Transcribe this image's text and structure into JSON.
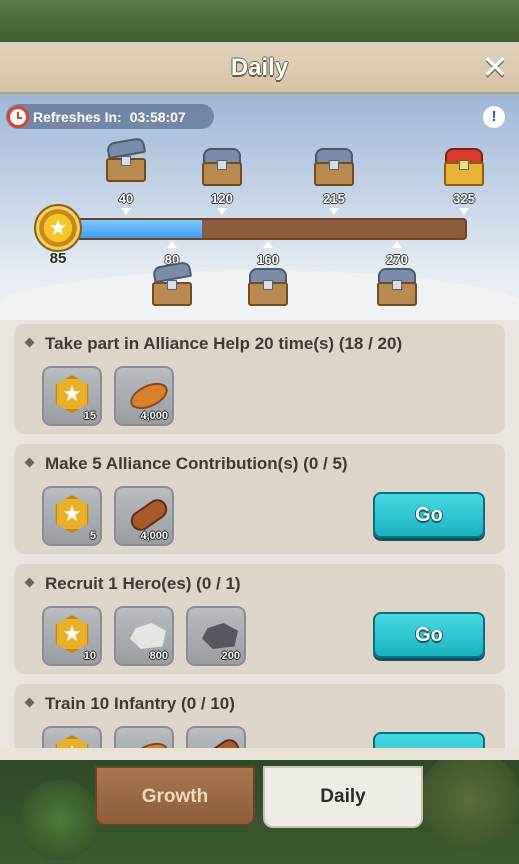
{
  "header": {
    "title": "Daily",
    "close_icon": "close-icon"
  },
  "refresh": {
    "label": "Refreshes In:",
    "time": "03:58:07"
  },
  "points": {
    "current": "85",
    "fill_fraction": 0.33,
    "icon": "star-icon"
  },
  "milestones": {
    "top": [
      {
        "value": "40",
        "chest": "silver-chest-open"
      },
      {
        "value": "120",
        "chest": "silver-chest"
      },
      {
        "value": "215",
        "chest": "silver-chest"
      },
      {
        "value": "325",
        "chest": "gold-chest"
      }
    ],
    "bottom": [
      {
        "value": "80",
        "chest": "silver-chest-open"
      },
      {
        "value": "160",
        "chest": "silver-chest"
      },
      {
        "value": "270",
        "chest": "silver-chest"
      }
    ]
  },
  "tasks": [
    {
      "title": "Take part in Alliance Help 20 time(s) (18 / 20)",
      "rewards": [
        {
          "icon": "star-hex-icon",
          "count": "15"
        },
        {
          "icon": "bread-icon",
          "count": "4,000"
        }
      ],
      "go_label": ""
    },
    {
      "title": "Make 5 Alliance Contribution(s) (0 / 5)",
      "rewards": [
        {
          "icon": "star-hex-icon",
          "count": "5"
        },
        {
          "icon": "wood-log-icon",
          "count": "4,000"
        }
      ],
      "go_label": "Go"
    },
    {
      "title": "Recruit 1 Hero(es) (0 / 1)",
      "rewards": [
        {
          "icon": "star-hex-icon",
          "count": "10"
        },
        {
          "icon": "stone-icon",
          "count": "800"
        },
        {
          "icon": "iron-ore-icon",
          "count": "200"
        }
      ],
      "go_label": "Go"
    },
    {
      "title": "Train 10 Infantry (0 / 10)",
      "rewards": [],
      "go_label": ""
    }
  ],
  "tabs": [
    {
      "label": "Growth",
      "active": false
    },
    {
      "label": "Daily",
      "active": true
    }
  ]
}
